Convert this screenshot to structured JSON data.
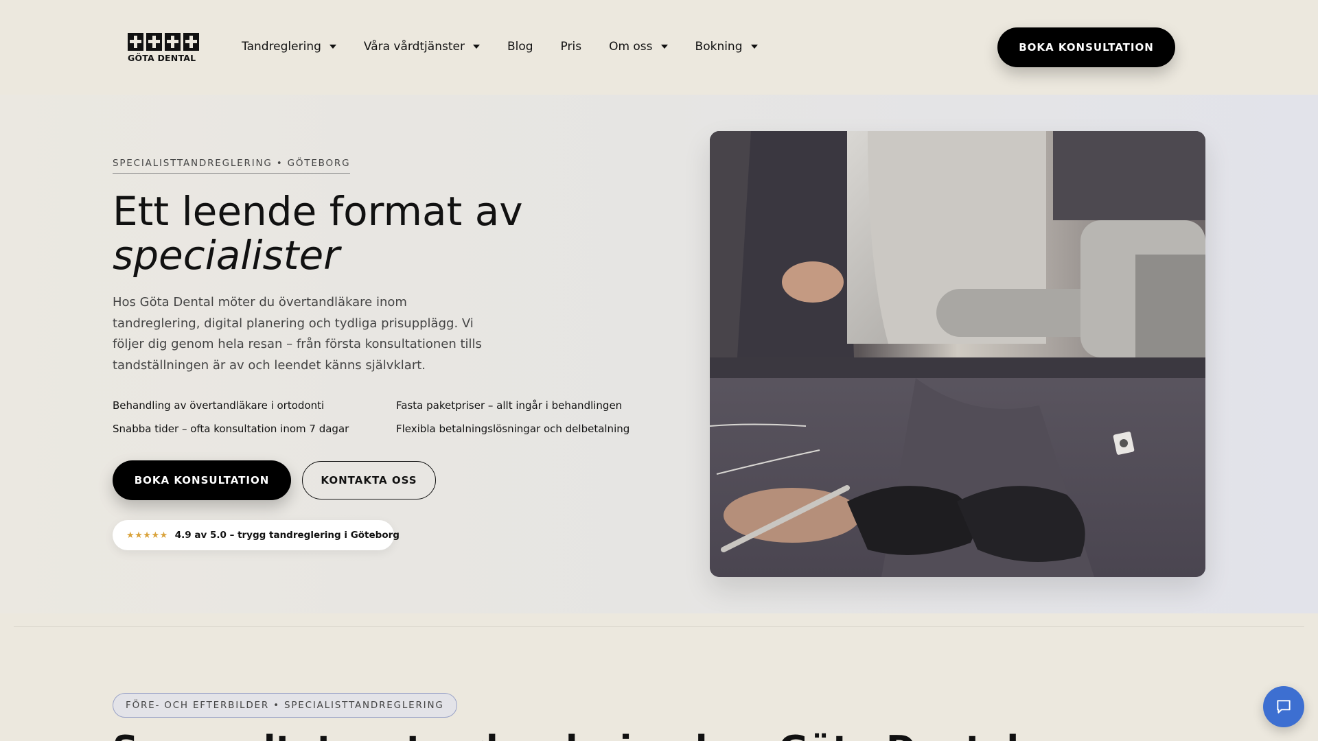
{
  "brand": {
    "logo_text": "GÖTA DENTAL"
  },
  "nav": {
    "items": [
      {
        "label": "Tandreglering",
        "dropdown": true
      },
      {
        "label": "Våra vårdtjänster",
        "dropdown": true
      },
      {
        "label": "Blog",
        "dropdown": false
      },
      {
        "label": "Pris",
        "dropdown": false
      },
      {
        "label": "Om oss",
        "dropdown": true
      },
      {
        "label": "Bokning",
        "dropdown": true
      }
    ],
    "cta_label": "BOKA KONSULTATION"
  },
  "hero": {
    "eyebrow": "SPECIALISTTANDREGLERING • GÖTEBORG",
    "title_line1": "Ett leende format av",
    "title_line2": "specialister",
    "description": "Hos Göta Dental möter du övertandläkare inom tandreglering, digital planering och tydliga prisupplägg. Vi följer dig genom hela resan – från första konsultationen tills tandställningen är av och leendet känns självklart.",
    "features": [
      "Behandling av övertandläkare i ortodonti",
      "Fasta paketpriser – allt ingår i behandlingen",
      "Snabba tider – ofta konsultation inom 7 dagar",
      "Flexibla betalningslösningar och delbetalning"
    ],
    "primary_button": "BOKA KONSULTATION",
    "secondary_button": "KONTAKTA OSS",
    "rating": {
      "stars": "★★★★★",
      "text": "4.9 av 5.0 – trygg tandreglering i Göteborg"
    }
  },
  "section2": {
    "badge": "FÖRE- OCH EFTERBILDER • SPECIALISTTANDREGLERING",
    "title": "Se resultat av tandreglering hos Göta Dental"
  },
  "chat": {
    "icon": "chat-bubble-icon"
  },
  "colors": {
    "background": "#ece8de",
    "primary": "#000000",
    "chat": "#3d6fd1",
    "star": "#d9a23a"
  }
}
